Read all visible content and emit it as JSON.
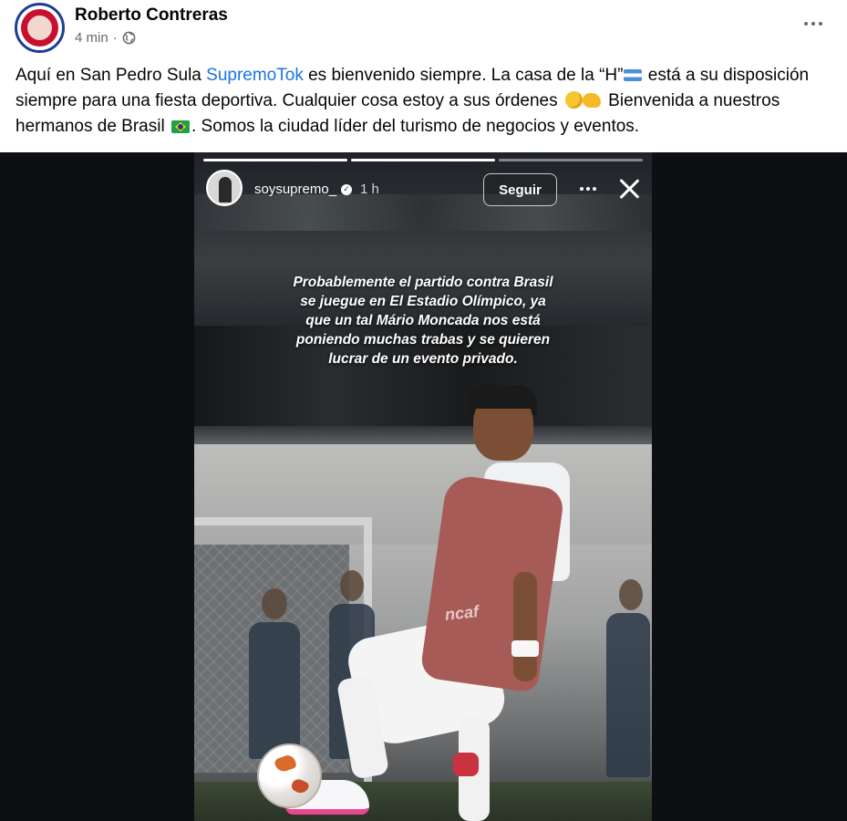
{
  "post": {
    "author": "Roberto Contreras",
    "time": "4 min",
    "separator": "·",
    "text": {
      "part1": "Aquí en San Pedro Sula ",
      "mention": "SupremoTok",
      "part2": " es bienvenido siempre. La casa de la “H”",
      "part3": " está a su disposición siempre para una fiesta deportiva. Cualquier cosa estoy a sus órdenes ",
      "part4": " Bienvenida a nuestros hermanos de Brasil ",
      "part5": ". Somos la ciudad líder del turismo de negocios y eventos."
    },
    "icons": {
      "privacy": "globe-icon",
      "more": "more-horizontal-icon",
      "flag_honduras": "honduras-flag-icon",
      "flag_brazil": "brazil-flag-icon"
    }
  },
  "story": {
    "username": "soysupremo_",
    "time": "1 h",
    "follow_label": "Seguir",
    "caption_lines": [
      "Probablemente el partido contra Brasil",
      "se juegue en El Estadio Olímpico, ya",
      "que un tal Mário Moncada nos está",
      "poniendo muchas trabas y se quieren",
      "lucrar de un evento privado."
    ],
    "bib_text": "ncaf",
    "progress_segments": [
      {
        "done": true
      },
      {
        "done": true
      },
      {
        "done": false
      }
    ]
  },
  "colors": {
    "mention": "#1b74e4",
    "meta_text": "#65676b",
    "media_background": "#0e0f12",
    "bib": "#a65b57"
  }
}
